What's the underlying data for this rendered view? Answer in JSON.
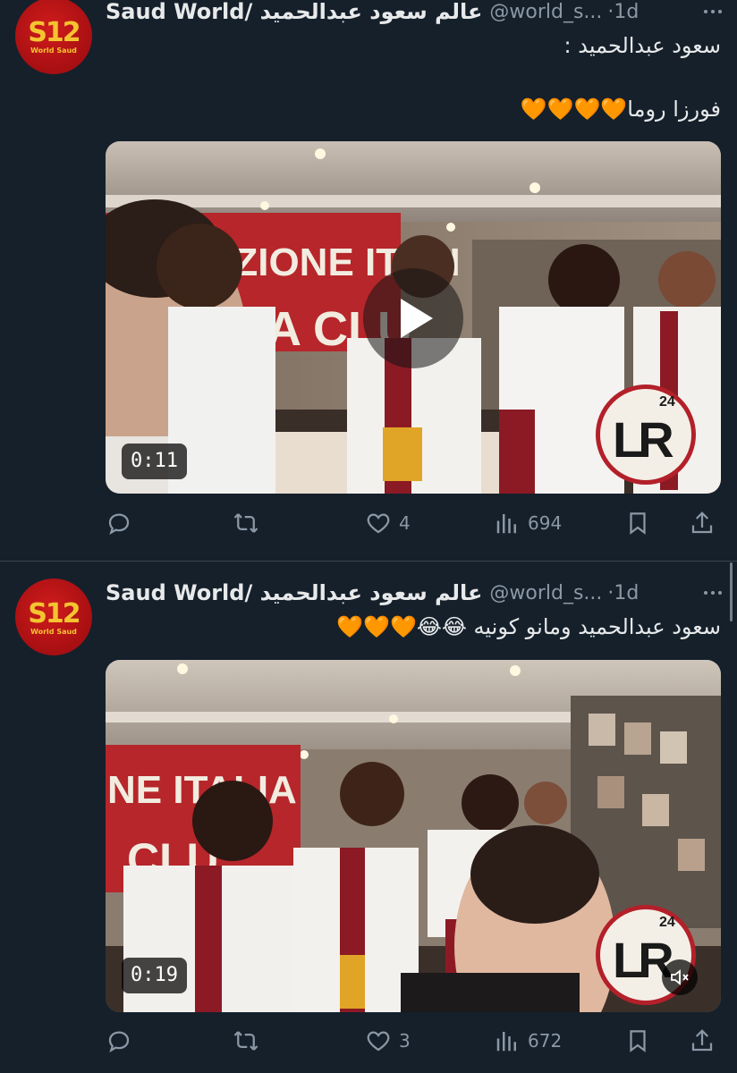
{
  "colors": {
    "background": "#15202b",
    "divider": "#38444d",
    "text": "#e7e9ea",
    "secondary": "#8b98a5",
    "brand_red": "#b3202a",
    "logo_gold": "#f4c430"
  },
  "tweets": [
    {
      "author_name": "عالم سعود عبدالحميد /Saud World",
      "handle": "@world_s...",
      "time": "·1d",
      "avatar_logo": "S12",
      "avatar_sub": "World Saud",
      "text_line_1": "سعود عبدالحميد :",
      "text_line_2": "فورزا روما🧡🧡🧡🧡",
      "video_duration": "0:11",
      "has_play_button": true,
      "overlay_logo": "LR",
      "overlay_logo_sup": "24",
      "actions": {
        "reply": "",
        "retweet": "",
        "likes": "4",
        "views": "694"
      },
      "icons": [
        "reply-icon",
        "retweet-icon",
        "like-icon",
        "views-icon",
        "bookmark-icon",
        "share-icon"
      ]
    },
    {
      "author_name": "عالم سعود عبدالحميد /Saud World",
      "handle": "@world_s...",
      "time": "·1d",
      "avatar_logo": "S12",
      "avatar_sub": "World Saud",
      "text_line_1": "سعود عبدالحميد  ومانو كونيه 😂😂🧡🧡🧡",
      "video_duration": "0:19",
      "has_play_button": false,
      "overlay_logo": "LR",
      "overlay_logo_sup": "24",
      "muted": true,
      "actions": {
        "reply": "",
        "retweet": "",
        "likes": "3",
        "views": "672"
      },
      "icons": [
        "reply-icon",
        "retweet-icon",
        "like-icon",
        "views-icon",
        "bookmark-icon",
        "share-icon"
      ]
    }
  ]
}
